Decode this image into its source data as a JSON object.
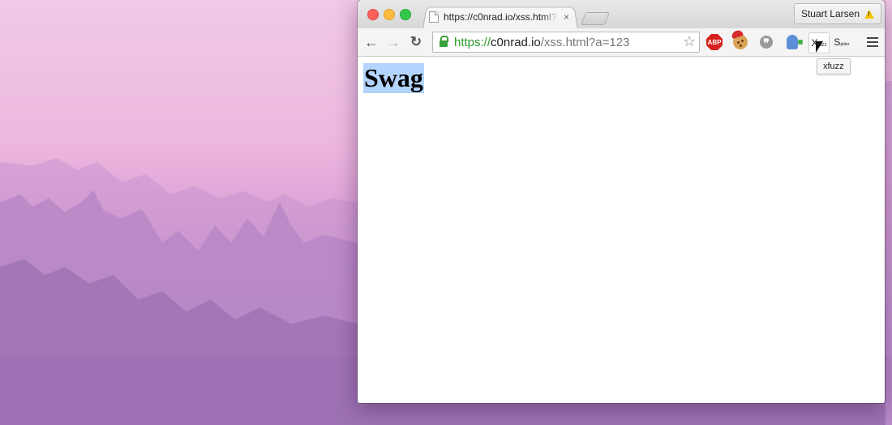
{
  "browser": {
    "tab": {
      "title": "https://c0nrad.io/xss.html?",
      "close_icon": "×"
    },
    "profile": {
      "name": "Stuart Larsen",
      "icon": "warning-icon"
    },
    "omnibox": {
      "scheme": "https://",
      "host": "c0nrad.io",
      "path": "/xss.html?a=123"
    },
    "extensions": {
      "abp_label": "ABP",
      "xfuzz_label": "X",
      "xfuzz_sub": "fuzz",
      "spider_label": "S",
      "spider_sub": "pider",
      "tooltip": "xfuzz"
    },
    "nav": {
      "back": "←",
      "forward": "→",
      "reload": "↻",
      "star": "☆"
    }
  },
  "page": {
    "heading": "Swag"
  },
  "colors": {
    "selection": "#b3d4fc",
    "secure": "#2b9b2b",
    "abp": "#d9201d"
  }
}
